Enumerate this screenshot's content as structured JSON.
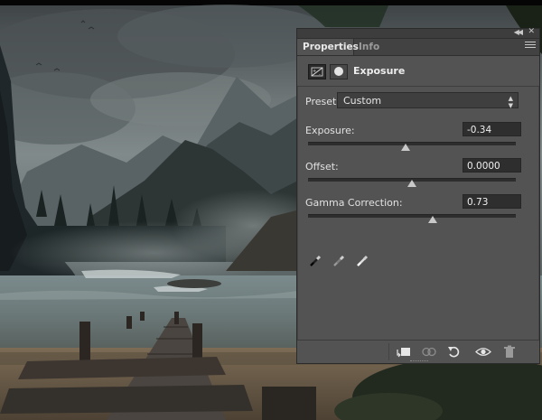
{
  "panel": {
    "tabs": [
      {
        "label": "Properties",
        "active": true
      },
      {
        "label": "Info",
        "active": false
      }
    ],
    "adjustment_title": "Exposure",
    "preset": {
      "label": "Preset:",
      "value": "Custom"
    },
    "controls": [
      {
        "label": "Exposure:",
        "value": "-0.34",
        "slider_fraction": 0.47
      },
      {
        "label": "Offset:",
        "value": "0.0000",
        "slider_fraction": 0.5
      },
      {
        "label": "Gamma Correction:",
        "value": "0.73",
        "slider_fraction": 0.6
      }
    ],
    "eyedroppers": [
      "eyedropper-black-icon",
      "eyedropper-gray-icon",
      "eyedropper-white-icon"
    ],
    "footer_icons": [
      "clip-to-layer-icon",
      "view-previous-state-icon",
      "reset-icon",
      "visibility-eye-icon",
      "trash-icon"
    ]
  },
  "colors": {
    "panel_bg": "#535353",
    "tab_bar": "#424242",
    "field_bg": "#2e2e2e",
    "text": "#e2e2e2"
  }
}
